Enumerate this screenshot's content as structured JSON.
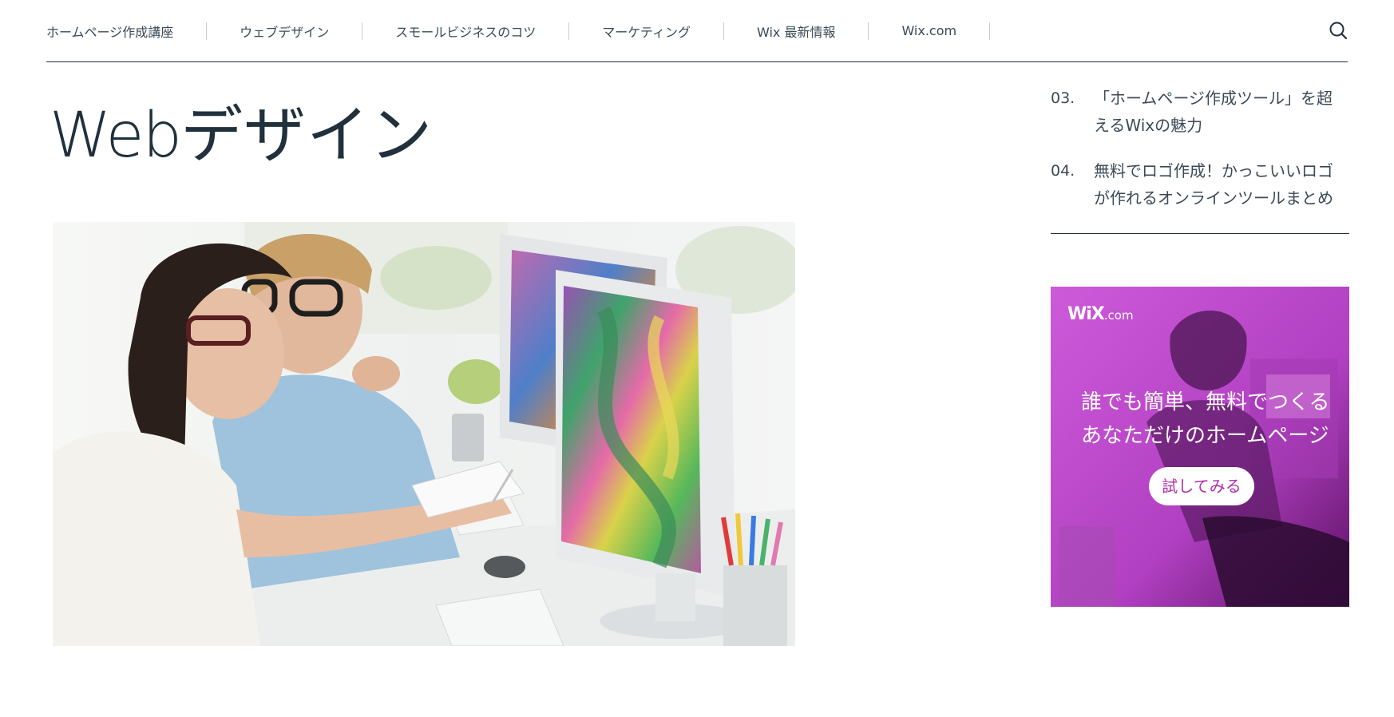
{
  "nav": {
    "items": [
      {
        "label": "ホームページ作成講座"
      },
      {
        "label": "ウェブデザイン"
      },
      {
        "label": "スモールビジネスのコツ"
      },
      {
        "label": "マーケティング"
      },
      {
        "label": "Wix 最新情報"
      },
      {
        "label": "Wix.com"
      }
    ],
    "search_icon": "search-icon"
  },
  "page": {
    "title_latin": "Web",
    "title_jp": "デザイン"
  },
  "hero": {
    "icon": "photo-designers-at-monitors"
  },
  "sidebar": {
    "list": [
      {
        "num": "03.",
        "line1": "「ホームページ作成ツール」を超",
        "line2": "えるWixの魅力"
      },
      {
        "num": "04.",
        "line1": "無料でロゴ作成！かっこいいロゴ",
        "line2": "が作れるオンラインツールまとめ"
      }
    ]
  },
  "ad": {
    "logo_main": "WiX",
    "logo_suffix": ".com",
    "headline_1": "誰でも簡単、無料でつくる",
    "headline_2": "あなただけのホームページ",
    "cta": "試してみる",
    "accent_color": "#c04ccf",
    "cta_text_color": "#b030a8"
  },
  "colors": {
    "text_dark": "#20303c",
    "nav_text": "#3a4a55"
  }
}
